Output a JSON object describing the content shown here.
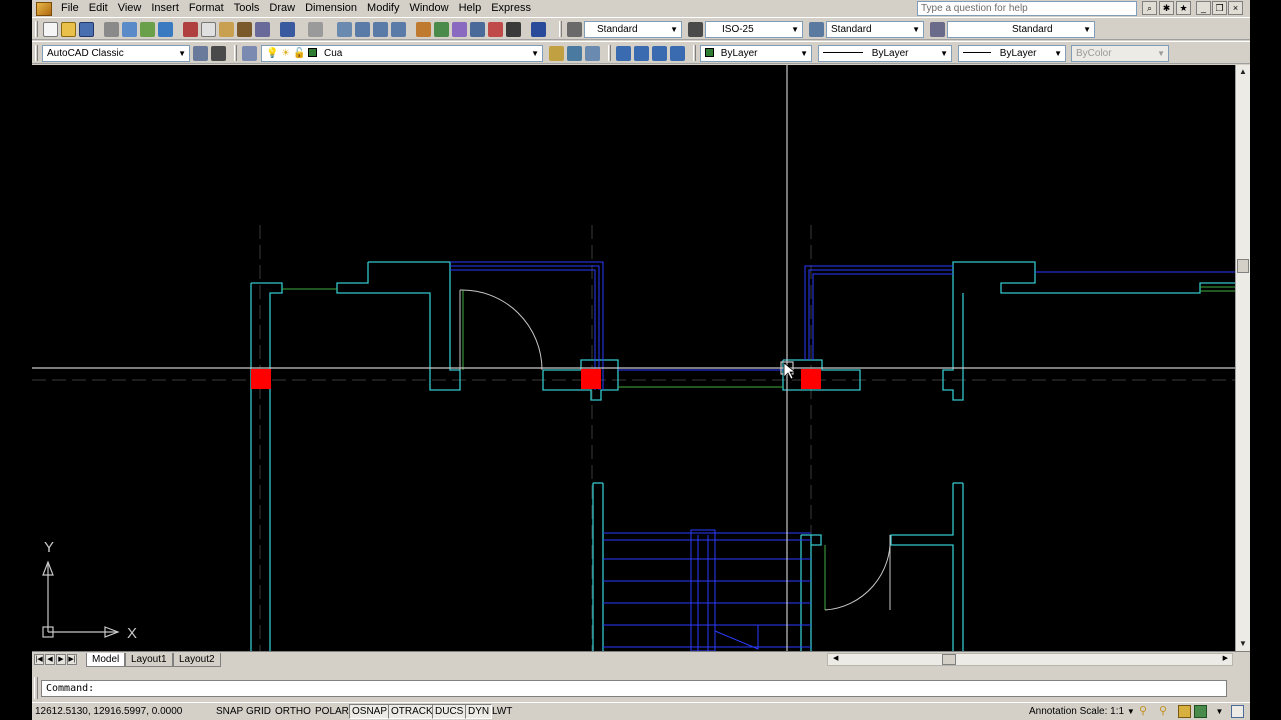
{
  "menubar": {
    "items": [
      "File",
      "Edit",
      "View",
      "Insert",
      "Format",
      "Tools",
      "Draw",
      "Dimension",
      "Modify",
      "Window",
      "Help",
      "Express"
    ],
    "help_placeholder": "Type a question for help"
  },
  "toolbar_styles": {
    "text_style": "Standard",
    "dim_style": "ISO-25",
    "table_style": "Standard",
    "multileader_style": "Standard"
  },
  "toolbar_layers": {
    "workspace": "AutoCAD Classic",
    "layer": "Cua",
    "color": "ByLayer",
    "linetype": "ByLayer",
    "lineweight": "ByLayer",
    "plotstyle": "ByColor",
    "color_swatch": "#2f7d32"
  },
  "tabs": {
    "items": [
      "Model",
      "Layout1",
      "Layout2"
    ],
    "active": "Model"
  },
  "ucs": {
    "x_label": "X",
    "y_label": "Y"
  },
  "command": {
    "prompt": "Command:"
  },
  "status": {
    "coordinates": "12612.5130, 12916.5997, 0.0000",
    "toggles": [
      "SNAP",
      "GRID",
      "ORTHO",
      "POLAR",
      "OSNAP",
      "OTRACK",
      "DUCS",
      "DYN",
      "LWT"
    ],
    "annotation_label": "Annotation Scale:",
    "annotation_scale": "1:1"
  },
  "colors": {
    "wall": "#33c7cc",
    "door_frame": "#2a3cff",
    "door_arc": "#c8c8c8",
    "column": "#ff0000",
    "green_line": "#3fae3f",
    "center_line": "#3a3a3a",
    "crosshair": "#c8c8c8"
  }
}
